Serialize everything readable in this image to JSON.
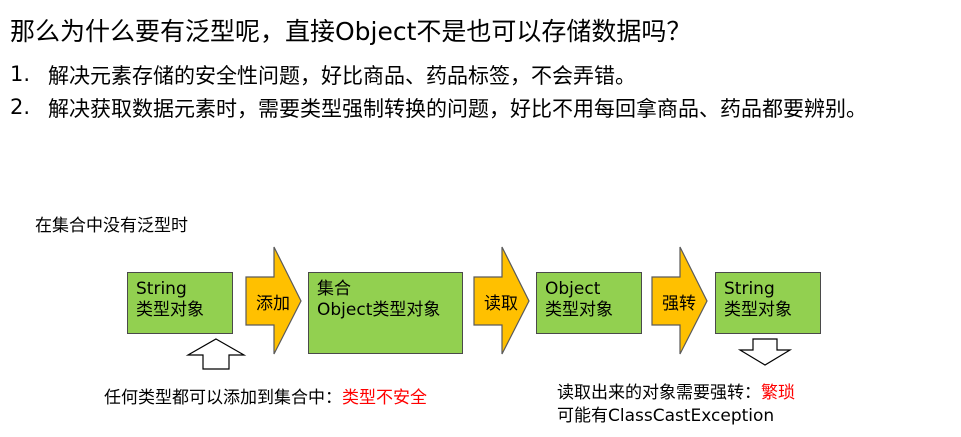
{
  "title": "那么为什么要有泛型呢，直接Object不是也可以存储数据吗？",
  "list": [
    {
      "num": "1.",
      "text": "解决元素存储的安全性问题，好比商品、药品标签，不会弄错。"
    },
    {
      "num": "2.",
      "text": "解决获取数据元素时，需要类型强制转换的问题，好比不用每回拿商品、药品都要辨别。"
    }
  ],
  "diagram": {
    "subtitle": "在集合中没有泛型时",
    "boxes": [
      {
        "line1": "String",
        "line2": "类型对象"
      },
      {
        "line1": "集合",
        "line2": "Object类型对象"
      },
      {
        "line1": "Object",
        "line2": "类型对象"
      },
      {
        "line1": "String",
        "line2": "类型对象"
      }
    ],
    "arrows": [
      "添加",
      "读取",
      "强转"
    ],
    "note_left": {
      "text": "任何类型都可以添加到集合中：",
      "highlight": "类型不安全"
    },
    "note_right": {
      "line1": "读取出来的对象需要强转：",
      "highlight": "繁琐",
      "line2": "可能有ClassCastException"
    },
    "colors": {
      "box": "#92d050",
      "arrow": "#ffc000",
      "highlight": "#ff0000"
    }
  }
}
